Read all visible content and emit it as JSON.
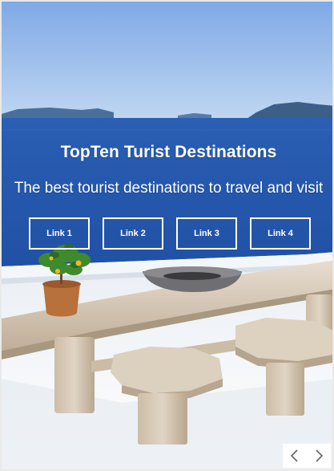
{
  "hero": {
    "title": "TopTen Turist Destinations",
    "subtitle": "The best tourist destinations to travel and visit"
  },
  "links": [
    {
      "label": "Link 1"
    },
    {
      "label": "Link 2"
    },
    {
      "label": "Link 3"
    },
    {
      "label": "Link 4"
    }
  ],
  "carousel": {
    "prev_icon": "chevron-left-icon",
    "next_icon": "chevron-right-icon"
  },
  "colors": {
    "sky_top": "#6f9ee0",
    "sea": "#2f63b8",
    "text": "#ffffff",
    "border": "#e9e9e9"
  }
}
